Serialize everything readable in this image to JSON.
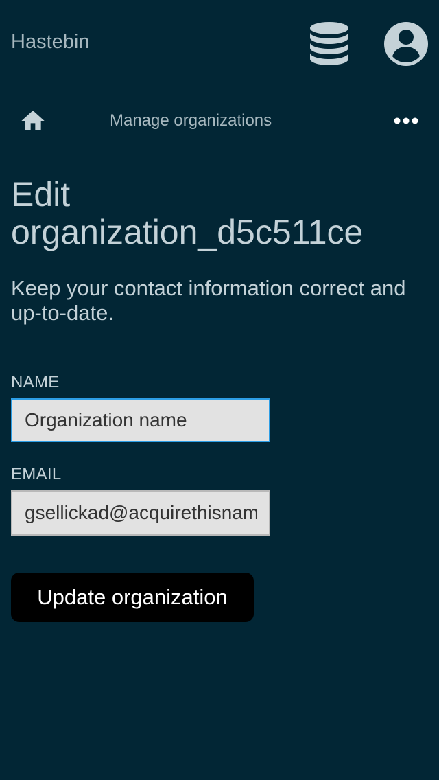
{
  "header": {
    "app_title": "Hastebin",
    "database_icon": "database-icon",
    "account_icon": "account-circle-icon"
  },
  "nav": {
    "home_icon": "home-icon",
    "link_label": "Manage organizations",
    "more_icon": "more-horizontal-icon"
  },
  "main": {
    "title": "Edit organization_d5c511ce",
    "subtitle": "Keep your contact information correct and up-to-date.",
    "form": {
      "name_label": "NAME",
      "name_value": "Organization name",
      "email_label": "EMAIL",
      "email_value": "gsellickad@acquirethisname.com",
      "submit_label": "Update organization"
    }
  },
  "colors": {
    "background": "#022635",
    "text": "#c4d2d8",
    "muted_text": "#a7b8bf",
    "input_background": "#e2e2e2",
    "focus_border": "#2d9ee6",
    "button_background": "#000000",
    "button_text": "#ffffff"
  }
}
